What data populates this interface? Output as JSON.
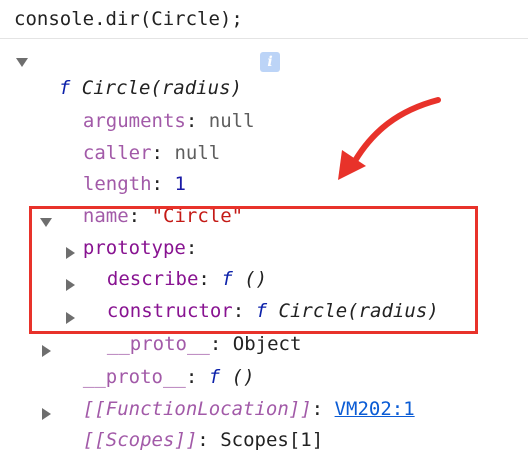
{
  "command": "console.dir(Circle);",
  "accent_color": "#e8322a",
  "root": {
    "f_symbol": "f",
    "signature": "Circle(radius)",
    "info_icon": "i"
  },
  "props": {
    "arguments": {
      "key": "arguments",
      "colon": ":",
      "value": "null"
    },
    "caller": {
      "key": "caller",
      "colon": ":",
      "value": "null"
    },
    "length": {
      "key": "length",
      "colon": ":",
      "value": "1"
    },
    "name": {
      "key": "name",
      "colon": ":",
      "value": "\"Circle\""
    }
  },
  "prototype": {
    "key": "prototype",
    "colon": ":",
    "children": {
      "describe": {
        "key": "describe",
        "colon": ":",
        "f_symbol": "f",
        "value": "()"
      },
      "constructor": {
        "key": "constructor",
        "colon": ":",
        "f_symbol": "f",
        "value": "Circle(radius)"
      },
      "proto": {
        "key": "__proto__",
        "colon": ":",
        "value": "Object"
      }
    }
  },
  "proto": {
    "key": "__proto__",
    "colon": ":",
    "f_symbol": "f",
    "value": "()"
  },
  "function_location": {
    "key": "[[FunctionLocation]]",
    "colon": ":",
    "value": "VM202:1"
  },
  "scopes": {
    "key": "[[Scopes]]",
    "colon": ":",
    "value": "Scopes[1]"
  }
}
